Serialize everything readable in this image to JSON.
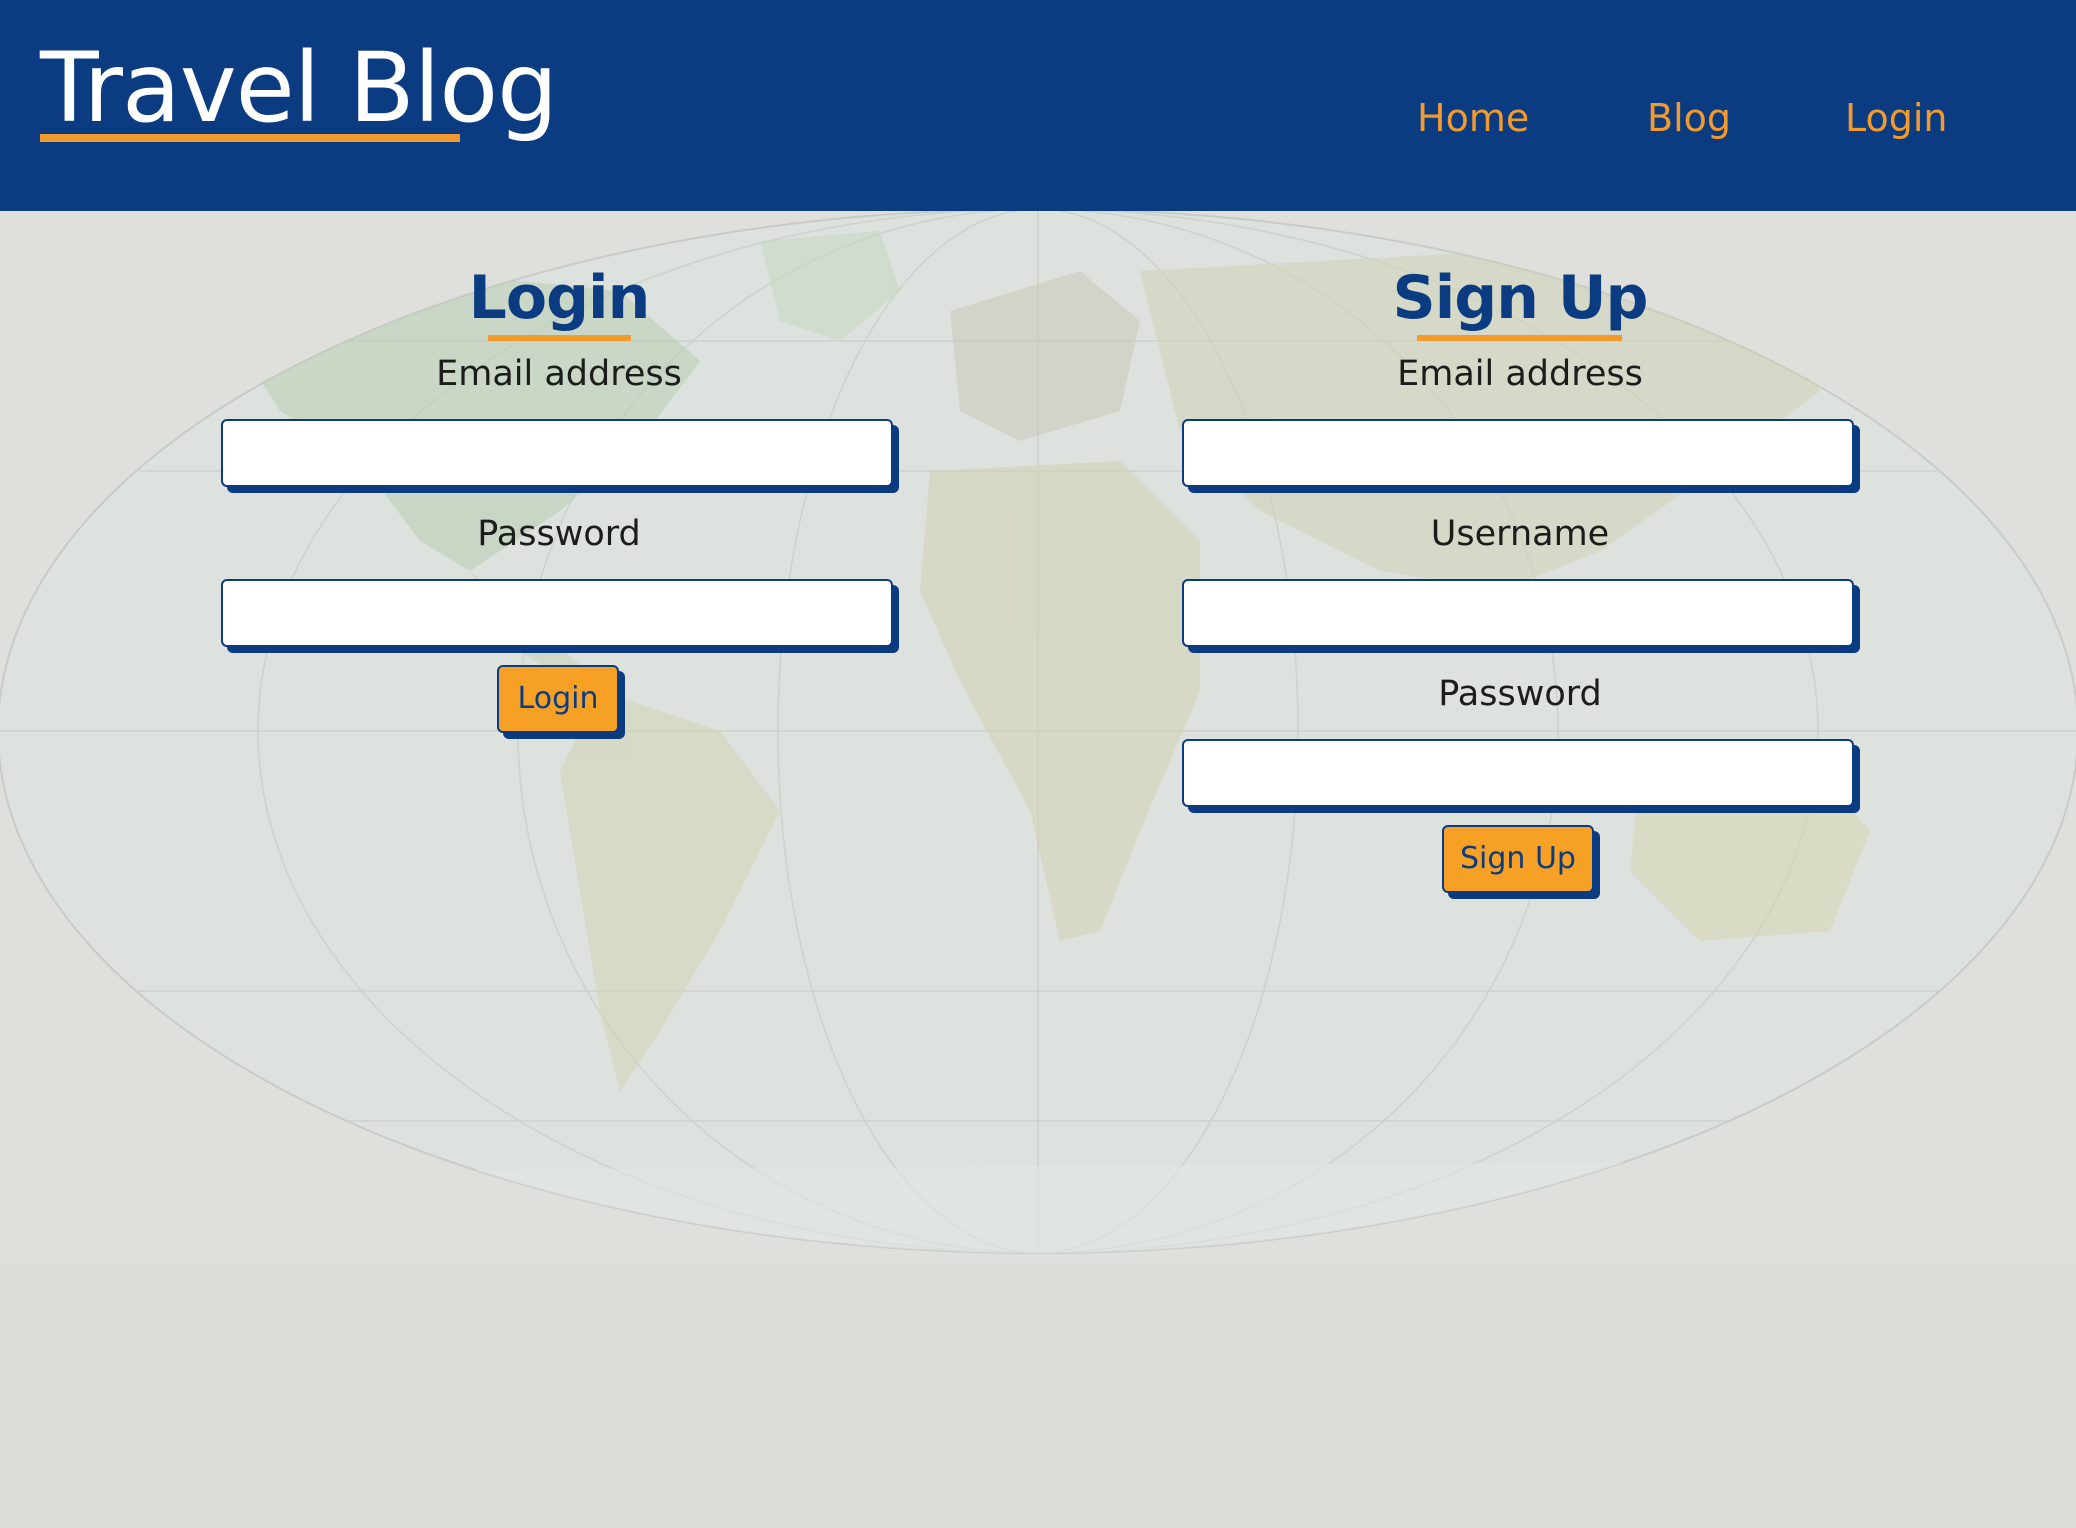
{
  "header": {
    "brand": "Travel Blog",
    "nav": {
      "home": "Home",
      "blog": "Blog",
      "login": "Login"
    }
  },
  "login_form": {
    "title": "Login",
    "email_label": "Email address",
    "email_value": "",
    "password_label": "Password",
    "password_value": "",
    "submit_label": "Login"
  },
  "signup_form": {
    "title": "Sign Up",
    "email_label": "Email address",
    "email_value": "",
    "username_label": "Username",
    "username_value": "",
    "password_label": "Password",
    "password_value": "",
    "submit_label": "Sign Up"
  },
  "colors": {
    "header_bg": "#0b3c82",
    "accent": "#f29a2e",
    "button_bg": "#f7a026",
    "page_bg": "#dadcd8"
  },
  "background": {
    "icon": "world-map-icon"
  }
}
